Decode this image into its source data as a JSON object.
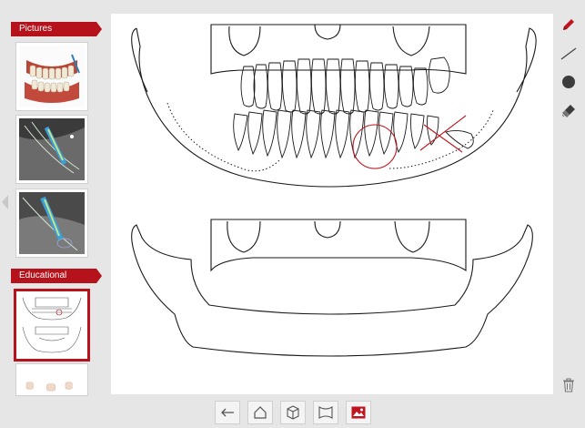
{
  "sidebar": {
    "pictures_label": "Pictures",
    "educational_label": "Educational"
  },
  "colors": {
    "accent": "#b5121b",
    "background": "#e6e6e6",
    "canvas": "#ffffff"
  },
  "toolbar": {
    "tools": [
      "pencil-icon",
      "line-icon",
      "circle-icon",
      "eraser-icon",
      "trash-icon"
    ]
  },
  "bottom_nav": {
    "buttons": [
      "back-arrow-icon",
      "home-icon",
      "cube-icon",
      "panoramic-icon",
      "image-icon"
    ],
    "active": "image-icon"
  }
}
